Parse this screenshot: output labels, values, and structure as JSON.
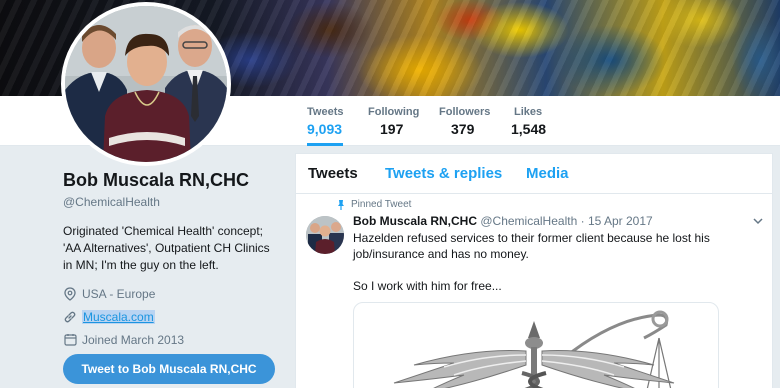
{
  "profile_nav": {
    "stats": [
      {
        "label": "Tweets",
        "value": "9,093",
        "active": true
      },
      {
        "label": "Following",
        "value": "197"
      },
      {
        "label": "Followers",
        "value": "379"
      },
      {
        "label": "Likes",
        "value": "1,548"
      }
    ]
  },
  "profile": {
    "name": "Bob Muscala RN,CHC",
    "handle": "@ChemicalHealth",
    "bio": "Originated 'Chemical Health' concept; 'AA Alternatives', Outpatient CH Clinics in MN; I'm the guy on the left.",
    "location": "USA - Europe",
    "website": "Muscala.com",
    "joined": "Joined March 2013",
    "tweet_button": "Tweet to Bob Muscala RN,CHC"
  },
  "timeline": {
    "tabs": [
      "Tweets",
      "Tweets & replies",
      "Media"
    ],
    "active_tab": "Tweets",
    "pinned_label": "Pinned Tweet",
    "tweet": {
      "name": "Bob Muscala RN,CHC",
      "handle": "@ChemicalHealth",
      "separator": "·",
      "date": "15 Apr 2017",
      "text_1": "Hazelden refused services to their former client because he lost his job/insurance and has no money.",
      "text_2": "So I work with him for free..."
    }
  },
  "colors": {
    "accent": "#1da1f2",
    "button": "#3b94d9",
    "link": "#1b95e0",
    "muted": "#657786",
    "background": "#e6ecf0"
  },
  "icons": [
    "location-icon",
    "link-icon",
    "calendar-icon",
    "pin-icon",
    "chevron-down-icon"
  ]
}
